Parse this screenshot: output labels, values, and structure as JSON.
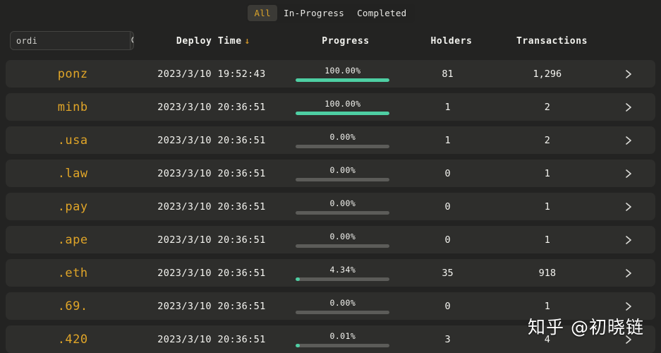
{
  "theme": {
    "page_bg": "#232322",
    "row_bg": "#2e2e2c",
    "accent_gold": "#e0a528",
    "progress_green": "#4ecfa3",
    "progress_track": "#5c5c59",
    "text_primary": "#f4f4f0"
  },
  "tabs": [
    {
      "label": "All",
      "active": true
    },
    {
      "label": "In-Progress",
      "active": false
    },
    {
      "label": "Completed",
      "active": false
    }
  ],
  "search": {
    "value": "ordi",
    "placeholder": "ordi",
    "icon": "search-icon"
  },
  "table": {
    "columns": [
      {
        "key": "ticker",
        "label": ""
      },
      {
        "key": "deploy_time",
        "label": "Deploy Time",
        "sort": "desc",
        "sort_glyph": "↓"
      },
      {
        "key": "progress",
        "label": "Progress"
      },
      {
        "key": "holders",
        "label": "Holders"
      },
      {
        "key": "transactions",
        "label": "Transactions"
      },
      {
        "key": "arrow",
        "label": ""
      }
    ],
    "row_arrow_icon": "chevron-right-icon",
    "rows": [
      {
        "ticker": "ponz",
        "deploy_time": "2023/3/10 19:52:43",
        "progress_label": "100.00%",
        "progress_pct": 100,
        "holders": "81",
        "transactions": "1,296"
      },
      {
        "ticker": "minb",
        "deploy_time": "2023/3/10 20:36:51",
        "progress_label": "100.00%",
        "progress_pct": 100,
        "holders": "1",
        "transactions": "2"
      },
      {
        "ticker": ".usa",
        "deploy_time": "2023/3/10 20:36:51",
        "progress_label": "0.00%",
        "progress_pct": 0,
        "holders": "1",
        "transactions": "2"
      },
      {
        "ticker": ".law",
        "deploy_time": "2023/3/10 20:36:51",
        "progress_label": "0.00%",
        "progress_pct": 0,
        "holders": "0",
        "transactions": "1"
      },
      {
        "ticker": ".pay",
        "deploy_time": "2023/3/10 20:36:51",
        "progress_label": "0.00%",
        "progress_pct": 0,
        "holders": "0",
        "transactions": "1"
      },
      {
        "ticker": ".ape",
        "deploy_time": "2023/3/10 20:36:51",
        "progress_label": "0.00%",
        "progress_pct": 0,
        "holders": "0",
        "transactions": "1"
      },
      {
        "ticker": ".eth",
        "deploy_time": "2023/3/10 20:36:51",
        "progress_label": "4.34%",
        "progress_pct": 4.34,
        "holders": "35",
        "transactions": "918"
      },
      {
        "ticker": ".69.",
        "deploy_time": "2023/3/10 20:36:51",
        "progress_label": "0.00%",
        "progress_pct": 0,
        "holders": "0",
        "transactions": "1"
      },
      {
        "ticker": ".420",
        "deploy_time": "2023/3/10 20:36:51",
        "progress_label": "0.01%",
        "progress_pct": 0.01,
        "holders": "3",
        "transactions": "4"
      }
    ]
  },
  "watermark": {
    "text": "知乎 @初晓链"
  }
}
